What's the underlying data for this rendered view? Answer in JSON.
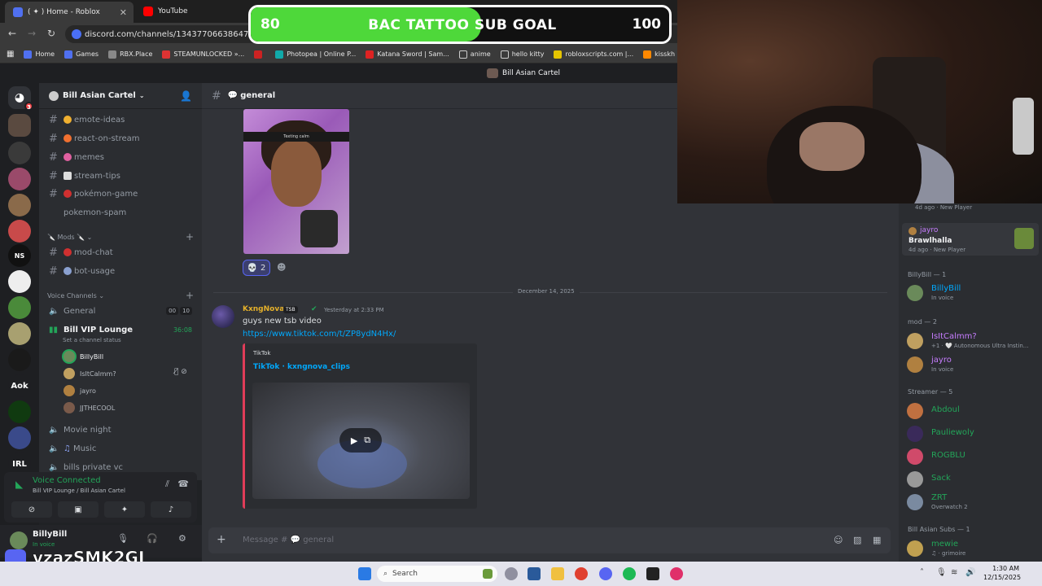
{
  "browser": {
    "tabs": [
      {
        "label": "( ✦ ) Home - Roblox",
        "active": true
      },
      {
        "label": "YouTube",
        "active": false
      }
    ],
    "url": "discord.com/channels/1343770663864766484/13",
    "bookmarks": [
      "Home",
      "Games",
      "RBX.Place",
      "STEAMUNLOCKED »...",
      "Photopea | Online P...",
      "Katana Sword | Sam...",
      "anime",
      "hello kitty",
      "robloxscripts.com |...",
      "kisskh | Asian Dram..."
    ]
  },
  "overlay": {
    "goal_low": "80",
    "goal_title": "BAC TATTOO SUB GOAL",
    "goal_high": "100",
    "goal_fraction": 0.55,
    "watermark": "vzazSMK2GJ"
  },
  "discord": {
    "window_title": "Bill Asian Cartel",
    "mention_badge": "3",
    "server_tile_labels": [
      "NS",
      "Aok",
      "IRL"
    ],
    "guild_name": "Bill Asian Cartel",
    "text_channels": [
      "emote-ideas",
      "react-on-stream",
      "memes",
      "stream-tips",
      "pokémon-game",
      "pokemon-spam"
    ],
    "mods_category": "Mods",
    "mods_channels": [
      "mod-chat",
      "bot-usage"
    ],
    "voice_category": "Voice Channels",
    "voice_channels": {
      "general": {
        "name": "General",
        "count_a": "00",
        "count_b": "10"
      },
      "vip": {
        "name": "Bill VIP Lounge",
        "timer": "36:08",
        "status": "Set a channel status"
      },
      "vip_users": [
        "BillyBill",
        "IsItCalmm?",
        "jayro",
        "JJTHECOOL"
      ],
      "movie": "Movie night",
      "music": "Music",
      "private": "bills private vc"
    },
    "voice_panel": {
      "status": "Voice Connected",
      "location": "Bill VIP Lounge / Bill Asian Cartel"
    },
    "user": {
      "name": "BillyBill",
      "status": "In voice"
    },
    "chat": {
      "channel": "general",
      "image_caption": "Texting calm",
      "reaction_count": "2",
      "date_divider": "December 14, 2025",
      "author": "KxngNova",
      "author_tag": "TSB",
      "timestamp": "Yesterday at 2:33 PM",
      "text": "guys new tsb video",
      "link": "https://www.tiktok.com/t/ZP8ydN4Hx/",
      "embed_provider": "TikTok",
      "embed_title": "TikTok · kxngnova_clips",
      "composer_placeholder": "Message # 💬 general"
    },
    "members": {
      "top": [
        {
          "name": "",
          "status": "4d ago · New Player"
        },
        {
          "name": "jayro",
          "game": "Brawlhalla",
          "status": "4d ago · New Player"
        }
      ],
      "groups": [
        {
          "label": "BillyBill — 1",
          "items": [
            {
              "name": "BillyBill",
              "status": "In voice",
              "color": "#00a8fc"
            }
          ]
        },
        {
          "label": "mod — 2",
          "items": [
            {
              "name": "IsItCalmm?",
              "status": "+1 · 🤍 Autonomous Ultra Instin...",
              "color": "#c77dff"
            },
            {
              "name": "jayro",
              "status": "In voice",
              "color": "#c77dff"
            }
          ]
        },
        {
          "label": "Streamer — 5",
          "items": [
            {
              "name": "Abdoul",
              "status": "",
              "color": "#23a559"
            },
            {
              "name": "Pauliewoly",
              "status": "",
              "color": "#23a559"
            },
            {
              "name": "ROGBLU",
              "status": "",
              "color": "#23a559"
            },
            {
              "name": "Sack",
              "status": "",
              "color": "#23a559"
            },
            {
              "name": "ZRT",
              "status": "Overwatch 2",
              "color": "#23a559"
            }
          ]
        },
        {
          "label": "Bill Asian Subs — 1",
          "items": [
            {
              "name": "mewie",
              "status": "♫ · grimoire",
              "color": "#23a559"
            }
          ]
        }
      ]
    }
  },
  "taskbar": {
    "search_placeholder": "Search",
    "time": "1:30 AM",
    "date": "12/15/2025"
  }
}
